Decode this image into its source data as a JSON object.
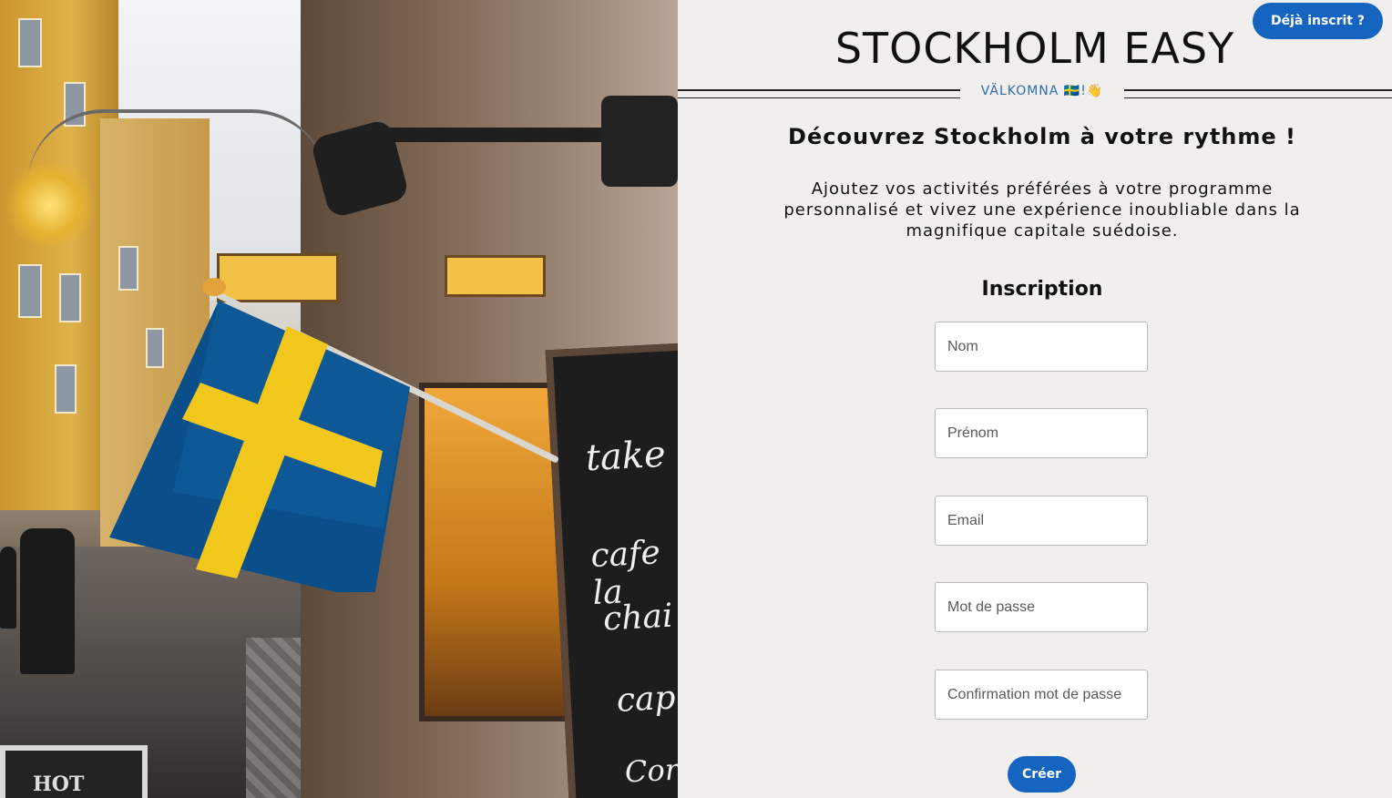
{
  "header": {
    "login_button": "Déjà inscrit ?",
    "brand": "STOCKHOLM EASY",
    "welcome": "VÄLKOMNA 🇸🇪!👋"
  },
  "intro": {
    "tagline": "Découvrez Stockholm à votre rythme !",
    "description": "Ajoutez vos activités préférées à votre programme personnalisé et vivez une expérience inoubliable dans la magnifique capitale suédoise."
  },
  "form": {
    "title": "Inscription",
    "fields": [
      {
        "placeholder": "Nom",
        "value": ""
      },
      {
        "placeholder": "Prénom",
        "value": ""
      },
      {
        "placeholder": "Email",
        "value": ""
      },
      {
        "placeholder": "Mot de passe",
        "value": ""
      },
      {
        "placeholder": "Confirmation mot de passe",
        "value": ""
      }
    ],
    "submit_label": "Créer"
  },
  "photo": {
    "board_words": [
      "take",
      "cafe la",
      "chai l",
      "cappu",
      "Corta"
    ],
    "hot_sign": "HOT"
  },
  "colors": {
    "accent": "#1565c0",
    "welcome_text": "#2d6cb0",
    "background": "#f1efed",
    "flag_blue": "#0b4f8a",
    "flag_yellow": "#f2c71b"
  }
}
